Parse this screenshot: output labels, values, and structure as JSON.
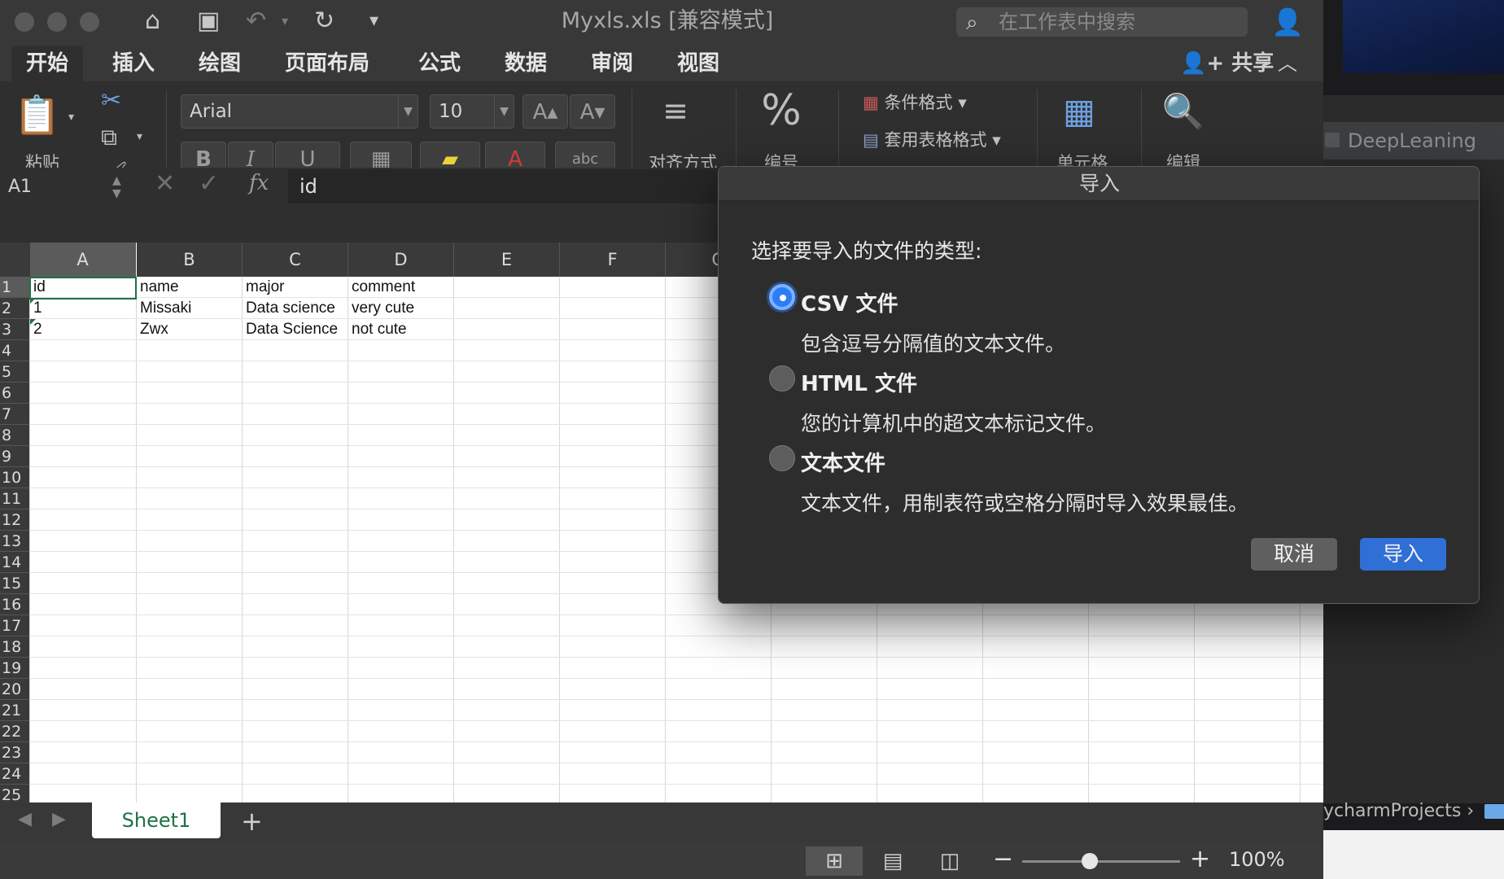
{
  "window": {
    "title": "Myxls.xls  [兼容模式]",
    "search_placeholder": "在工作表中搜索"
  },
  "tabs": [
    {
      "label": "开始",
      "active": true
    },
    {
      "label": "插入"
    },
    {
      "label": "绘图"
    },
    {
      "label": "页面布局"
    },
    {
      "label": "公式"
    },
    {
      "label": "数据"
    },
    {
      "label": "审阅"
    },
    {
      "label": "视图"
    }
  ],
  "share_label": "共享",
  "ribbon": {
    "paste_label": "粘贴",
    "font_name": "Arial",
    "font_size": "10",
    "bold": "B",
    "italic": "I",
    "underline": "U",
    "font_color_glyph": "A",
    "abc_glyph": "abc",
    "align_label": "对齐方式",
    "number_label": "编号",
    "conditional_format": "条件格式",
    "table_format": "套用表格格式",
    "cells_label": "单元格",
    "edit_label": "编辑"
  },
  "formula_bar": {
    "name_box": "A1",
    "fx": "fx",
    "value": "id"
  },
  "grid": {
    "columns": [
      "A",
      "B",
      "C",
      "D",
      "E",
      "F",
      "G"
    ],
    "rows": [
      "1",
      "2",
      "3",
      "4",
      "5",
      "6",
      "7",
      "8",
      "9",
      "10",
      "11",
      "12",
      "13",
      "14",
      "15",
      "16",
      "17",
      "18",
      "19",
      "20",
      "21",
      "22",
      "23",
      "24",
      "25"
    ],
    "data": [
      [
        "id",
        "name",
        "major",
        "comment"
      ],
      [
        "1",
        "Missaki",
        "Data science",
        "very cute"
      ],
      [
        "2",
        "Zwx",
        "Data Science",
        "not cute"
      ]
    ]
  },
  "sheets": [
    "Sheet1"
  ],
  "status": {
    "zoom": "100%",
    "zoom_level": 0.43
  },
  "dialog": {
    "title": "导入",
    "prompt": "选择要导入的文件的类型:",
    "options": [
      {
        "label": "CSV 文件",
        "desc": "包含逗号分隔值的文本文件。",
        "checked": true
      },
      {
        "label": "HTML 文件",
        "desc": "您的计算机中的超文本标记文件。",
        "checked": false
      },
      {
        "label": "文本文件",
        "desc": "文本文件，用制表符或空格分隔时导入效果最佳。",
        "checked": false
      }
    ],
    "cancel_label": "取消",
    "import_label": "导入"
  },
  "background": {
    "pycharm_tab": "DeepLeaning",
    "pycharm_breadcrumb": "ycharmProjects ›"
  }
}
